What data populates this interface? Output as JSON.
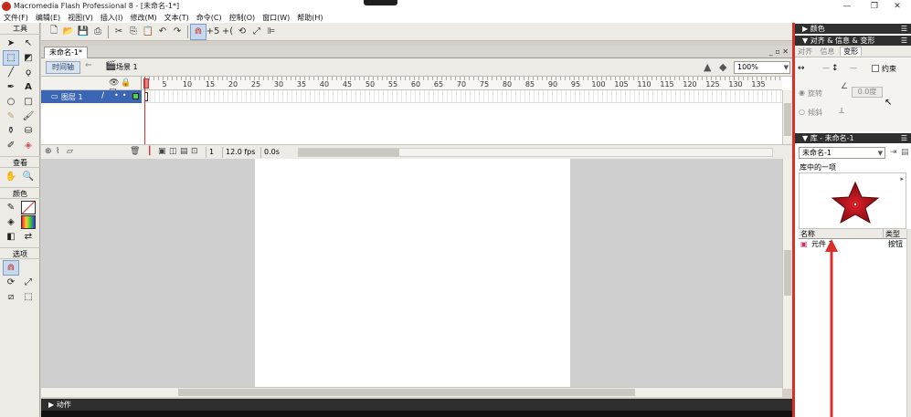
{
  "window": {
    "title": "Macromedia Flash Professional 8 - [未命名-1*]",
    "controls": [
      "—",
      "❐",
      "✕"
    ]
  },
  "menu": [
    "文件(F)",
    "编辑(E)",
    "视图(V)",
    "插入(I)",
    "修改(M)",
    "文本(T)",
    "命令(C)",
    "控制(O)",
    "窗口(W)",
    "帮助(H)"
  ],
  "tools": {
    "title": "工具",
    "view_label": "查看",
    "colors_label": "颜色",
    "options_label": "选项"
  },
  "document": {
    "tab": "未命名-1*",
    "timeline_button": "时间轴",
    "scene": "场景 1",
    "zoom": "100%"
  },
  "timeline": {
    "layer_name": "图层 1",
    "frame_numbers": [
      5,
      10,
      15,
      20,
      25,
      30,
      35,
      40,
      45,
      50,
      55,
      60,
      65,
      70,
      75,
      80,
      85,
      90,
      95,
      100,
      105,
      110,
      115,
      120,
      125,
      130,
      135
    ],
    "current_frame": "1",
    "fps": "12.0 fps",
    "elapsed": "0.0s"
  },
  "actions_panel": {
    "label": "▶ 动作"
  },
  "right_panel": {
    "color_header": "▶ 颜色",
    "align_header": "▼ 对齐 & 信息 & 变形",
    "align_tabs": [
      "对齐",
      "信息",
      "变形"
    ],
    "transform": {
      "constrain": "约束",
      "rotate": "旋转",
      "skew": "倾斜",
      "rotate_value": "0.0度"
    },
    "library_header": "▼ 库 - 未命名-1",
    "library_doc": "未命名-1",
    "library_count": "库中的一项",
    "columns": {
      "name": "名称",
      "type": "类型"
    },
    "items": [
      {
        "name": "元件 1",
        "type": "按钮"
      }
    ]
  },
  "colors": {
    "accent": "#d8312b",
    "layer_selected": "#3a66b4",
    "star": "#b8141a"
  }
}
